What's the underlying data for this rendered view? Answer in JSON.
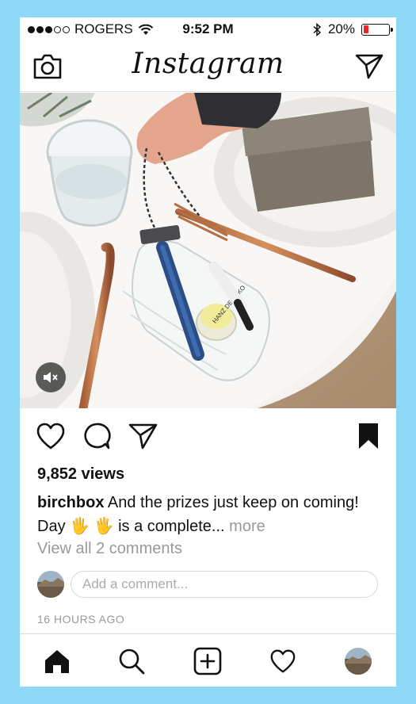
{
  "status_bar": {
    "carrier": "ROGERS",
    "time": "9:52 PM",
    "battery": "20%",
    "battery_level": 0.2,
    "signal_bars": 3,
    "signal_total": 5,
    "battery_color": "#e8252a"
  },
  "header": {
    "logo": "Instagram",
    "left_icon": "camera-icon",
    "right_icon": "direct-send-icon"
  },
  "post": {
    "mute_icon": "speaker-muted-icon",
    "views": "9,852 views",
    "username": "birchbox",
    "caption_start": "And the prizes just keep on coming! Day",
    "caption_emoji": "🖐 🖐",
    "caption_end": "is a complete...",
    "more_label": "more",
    "view_comments": "View all 2 comments",
    "comment_placeholder": "Add a comment...",
    "time_ago": "16 HOURS AGO"
  },
  "actions": {
    "icons": [
      "heart-icon",
      "comment-icon",
      "share-icon",
      "bookmark-icon"
    ]
  },
  "tab_bar": {
    "icons": [
      "home-icon",
      "search-icon",
      "add-post-icon",
      "activity-heart-icon",
      "profile-avatar"
    ]
  }
}
